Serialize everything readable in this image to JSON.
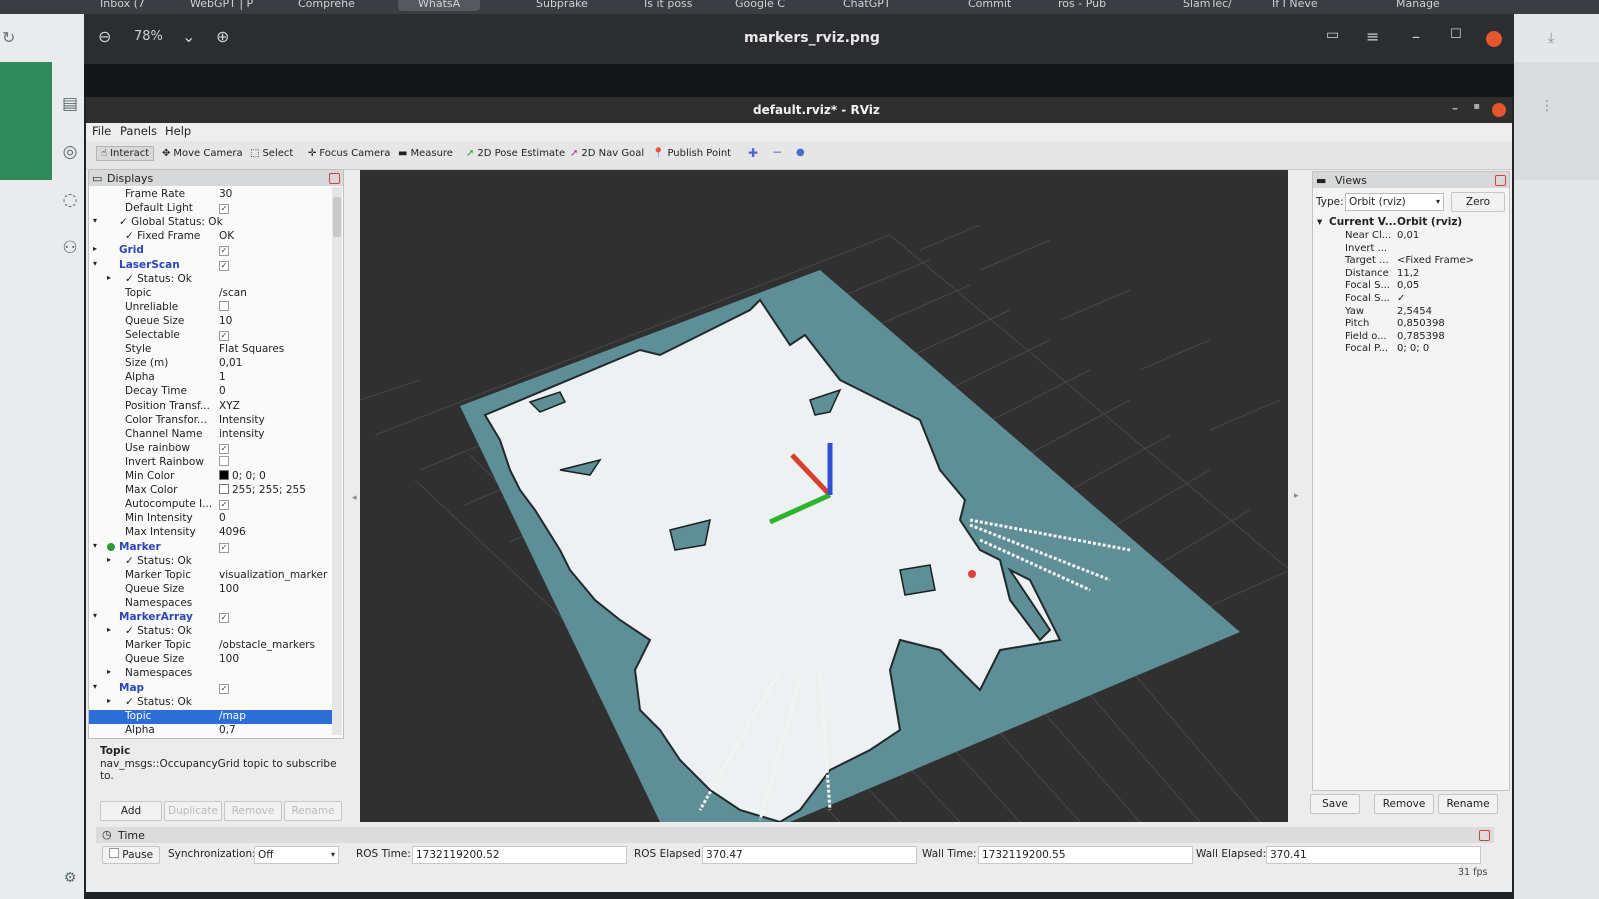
{
  "browser_tabs": [
    {
      "label": "Inbox (7"
    },
    {
      "label": "WebGPT | P"
    },
    {
      "label": "Comprehe"
    },
    {
      "label": "WhatsA",
      "active": true
    },
    {
      "label": "Subprake"
    },
    {
      "label": "Is it poss"
    },
    {
      "label": "Google C"
    },
    {
      "label": "ChatGPT"
    },
    {
      "label": "Commit"
    },
    {
      "label": "ros - Pub"
    },
    {
      "label": "SlamTec/"
    },
    {
      "label": "If I Neve"
    },
    {
      "label": "Manage"
    }
  ],
  "viewer": {
    "zoom": "78%",
    "title": "markers_rviz.png"
  },
  "rviz": {
    "window_title": "default.rviz* - RViz",
    "menu": [
      "File",
      "Panels",
      "Help"
    ],
    "toolbar": [
      {
        "label": "Interact",
        "icon": "hand-icon"
      },
      {
        "label": "Move Camera",
        "icon": "move-camera-icon"
      },
      {
        "label": "Select",
        "icon": "select-icon"
      },
      {
        "label": "Focus Camera",
        "icon": "focus-camera-icon"
      },
      {
        "label": "Measure",
        "icon": "ruler-icon"
      },
      {
        "label": "2D Pose Estimate",
        "icon": "pose-arrow-icon"
      },
      {
        "label": "2D Nav Goal",
        "icon": "nav-arrow-icon"
      },
      {
        "label": "Publish Point",
        "icon": "map-pin-icon"
      }
    ],
    "displays": {
      "title": "Displays",
      "rows": [
        {
          "k": "Frame Rate",
          "v": "30",
          "indent": 1
        },
        {
          "k": "Default Light",
          "v": "✓",
          "indent": 1,
          "check": true
        },
        {
          "k": "✓ Global Status: Ok",
          "v": "",
          "indent": 0,
          "arrow": "▾"
        },
        {
          "k": "✓ Fixed Frame",
          "v": "OK",
          "indent": 1
        },
        {
          "k": "Grid",
          "v": "✓",
          "indent": 0,
          "arrow": "▸",
          "plugin": true,
          "check": true
        },
        {
          "k": "LaserScan",
          "v": "✓",
          "indent": 0,
          "arrow": "▾",
          "plugin": true,
          "check": true
        },
        {
          "k": "✓ Status: Ok",
          "v": "",
          "indent": 1,
          "arrow": "▸"
        },
        {
          "k": "Topic",
          "v": "/scan",
          "indent": 1
        },
        {
          "k": "Unreliable",
          "v": "",
          "indent": 1,
          "check": true
        },
        {
          "k": "Queue Size",
          "v": "10",
          "indent": 1
        },
        {
          "k": "Selectable",
          "v": "✓",
          "indent": 1,
          "check": true
        },
        {
          "k": "Style",
          "v": "Flat Squares",
          "indent": 1
        },
        {
          "k": "Size (m)",
          "v": "0,01",
          "indent": 1
        },
        {
          "k": "Alpha",
          "v": "1",
          "indent": 1
        },
        {
          "k": "Decay Time",
          "v": "0",
          "indent": 1
        },
        {
          "k": "Position Transf...",
          "v": "XYZ",
          "indent": 1
        },
        {
          "k": "Color Transfor...",
          "v": "Intensity",
          "indent": 1
        },
        {
          "k": "Channel Name",
          "v": "intensity",
          "indent": 1
        },
        {
          "k": "Use rainbow",
          "v": "✓",
          "indent": 1,
          "check": true
        },
        {
          "k": "Invert Rainbow",
          "v": "",
          "indent": 1,
          "check": true
        },
        {
          "k": "Min Color",
          "v": "0; 0; 0",
          "indent": 1,
          "swatch": "#000000"
        },
        {
          "k": "Max Color",
          "v": "255; 255; 255",
          "indent": 1,
          "swatch": "#ffffff"
        },
        {
          "k": "Autocompute I...",
          "v": "✓",
          "indent": 1,
          "check": true
        },
        {
          "k": "Min Intensity",
          "v": "0",
          "indent": 1
        },
        {
          "k": "Max Intensity",
          "v": "4096",
          "indent": 1
        },
        {
          "k": "Marker",
          "v": "✓",
          "indent": 0,
          "arrow": "▾",
          "plugin": true,
          "check": true,
          "dot": "#2e9a32"
        },
        {
          "k": "✓ Status: Ok",
          "v": "",
          "indent": 1,
          "arrow": "▸"
        },
        {
          "k": "Marker Topic",
          "v": "visualization_marker",
          "indent": 1
        },
        {
          "k": "Queue Size",
          "v": "100",
          "indent": 1
        },
        {
          "k": "Namespaces",
          "v": "",
          "indent": 1
        },
        {
          "k": "MarkerArray",
          "v": "✓",
          "indent": 0,
          "arrow": "▾",
          "plugin": true,
          "check": true
        },
        {
          "k": "✓ Status: Ok",
          "v": "",
          "indent": 1,
          "arrow": "▸"
        },
        {
          "k": "Marker Topic",
          "v": "/obstacle_markers",
          "indent": 1
        },
        {
          "k": "Queue Size",
          "v": "100",
          "indent": 1
        },
        {
          "k": "Namespaces",
          "v": "",
          "indent": 1,
          "arrow": "▸"
        },
        {
          "k": "Map",
          "v": "✓",
          "indent": 0,
          "arrow": "▾",
          "plugin": true,
          "check": true
        },
        {
          "k": "✓ Status: Ok",
          "v": "",
          "indent": 1,
          "arrow": "▸"
        },
        {
          "k": "Topic",
          "v": "/map",
          "indent": 1,
          "selected": true
        },
        {
          "k": "Alpha",
          "v": "0,7",
          "indent": 1
        }
      ],
      "description_title": "Topic",
      "description_text": "nav_msgs::OccupancyGrid topic to subscribe to.",
      "buttons": [
        "Add",
        "Duplicate",
        "Remove",
        "Rename"
      ]
    },
    "views": {
      "title": "Views",
      "type_label": "Type:",
      "type_value": "Orbit (rviz)",
      "zero_label": "Zero",
      "current_label": "Current V...",
      "current_value": "Orbit (rviz)",
      "rows": [
        {
          "k": "Near Cl...",
          "v": "0,01"
        },
        {
          "k": "Invert ...",
          "v": ""
        },
        {
          "k": "Target ...",
          "v": "<Fixed Frame>"
        },
        {
          "k": "Distance",
          "v": "11,2"
        },
        {
          "k": "Focal S...",
          "v": "0,05"
        },
        {
          "k": "Focal S...",
          "v": "✓"
        },
        {
          "k": "Yaw",
          "v": "2,5454"
        },
        {
          "k": "Pitch",
          "v": "0,850398"
        },
        {
          "k": "Field o...",
          "v": "0,785398"
        },
        {
          "k": "Focal P...",
          "v": "0; 0; 0"
        }
      ],
      "buttons": [
        "Save",
        "Remove",
        "Rename"
      ]
    },
    "time": {
      "title": "Time",
      "pause_label": "Pause",
      "sync_label": "Synchronization:",
      "sync_value": "Off",
      "ros_time_label": "ROS Time:",
      "ros_time": "1732119200.52",
      "ros_elapsed_label": "ROS Elapsed:",
      "ros_elapsed": "370.47",
      "wall_time_label": "Wall Time:",
      "wall_time": "1732119200.55",
      "wall_elapsed_label": "Wall Elapsed:",
      "wall_elapsed": "370.41",
      "fps": "31 fps"
    }
  },
  "colors": {
    "selection": "#2c6ed8",
    "plugin_name": "#2b46b8",
    "map_floor": "#5e8e96",
    "free_space": "#eef1f1",
    "axis_x": "#d6402c",
    "axis_y": "#2db52d",
    "axis_z": "#2f4fd8",
    "close": "#e4572e"
  }
}
